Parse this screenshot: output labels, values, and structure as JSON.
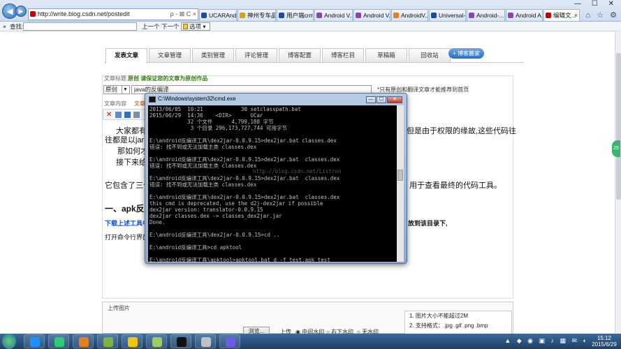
{
  "browser": {
    "address": "http://write.blog.csdn.net/postedit",
    "address_actions": "ρ - ⊠ C ×",
    "tabs": [
      {
        "label": "UCARAndr...",
        "color": "#1b4d9b"
      },
      {
        "label": "神州专车品...",
        "color": "#d4a017"
      },
      {
        "label": "用户端crm...",
        "color": "#1b4d9b"
      },
      {
        "label": "Android V...",
        "color": "#8e44ad"
      },
      {
        "label": "Android V...",
        "color": "#8e44ad"
      },
      {
        "label": "AndroidV...",
        "color": "#e67e22"
      },
      {
        "label": "Universal-...",
        "color": "#1b4d9b"
      },
      {
        "label": "Android-...",
        "color": "#8e44ad"
      },
      {
        "label": "Android A...",
        "color": "#8e44ad"
      },
      {
        "label": "编辑文...",
        "color": "#c00000",
        "active": true
      }
    ],
    "window_controls": "— ☐ ✕",
    "tool_icons": "⌂ ☆ ⚙"
  },
  "find_bar": {
    "close": "×",
    "label": "查找:",
    "prev": "上一个",
    "next": "下一个",
    "options": "选项 ▾"
  },
  "page": {
    "nav_tabs": [
      "发表文章",
      "文章管理",
      "类别管理",
      "评论管理",
      "博客配置",
      "博客栏目",
      "草稿箱",
      "回收站"
    ],
    "team_button": "+ 博客搬家",
    "title_label": "文章标题",
    "original_note": "原创 请保证您的文章为原创作品",
    "type_select": "原创",
    "title_value": "java的反编译",
    "right_note": "*只有原创和翻译文章才能推荐到首页",
    "content_label": "文章内容",
    "editor_label": "文章",
    "body": {
      "p1": "大家都有",
      "p1b": "往都是以jar",
      "p1_right": "但是由于权限的缘故,这些代码往",
      "p2": "那如何才",
      "p3": "接下来给",
      "p4": "它包含了三个",
      "p4_right": "用于查看最终的代码工具。",
      "h1": "一、apk反编",
      "blue": "下载上述工具中",
      "blue_right": "放到该目录下,",
      "cmdline": "打开命令行界面"
    },
    "upload": {
      "title": "上传图片",
      "browse": "浏览...",
      "upload_btn": "上传",
      "radios": [
        "中间水印",
        "右下水印",
        "无水印"
      ],
      "rule1": "1. 图片大小不能超过2M",
      "rule2": "2. 支持格式：.jpg .gif .png .bmp"
    },
    "side_badge": "25"
  },
  "cmd": {
    "title": "C:\\Windows\\system32\\cmd.exe",
    "lines": [
      "2013/06/05  10:21            30 setclasspath.bat",
      "2015/06/29  14:36    <DIR>      UCar",
      "            32 个文件      4,799,188 字节",
      "             3 个目录 296,173,727,744 可用字节",
      "",
      "E:\\android反编译工具\\dex2jar-0.0.9.15>dex2jar.bat classes.dex",
      "错误: 找不到或无法加载主类 classes.dex",
      "",
      "E:\\android反编译工具\\dex2jar-0.0.9.15>dex2jar.bat  classes.dex",
      "错误: 找不到或无法加载主类 classes.dex",
      "",
      "E:\\android反编译工具\\dex2jar-0.0.9.15>dex2jar.bat  classes.dex",
      "错误: 找不到或无法加载主类 classes.dex",
      "",
      "E:\\android反编译工具\\dex2jar-0.0.9.15>dex2jar.bat  classes.dex",
      "this cmd is deprecated, use the d2j-dex2jar if possible",
      "dex2jar version: translator-0.0.9.15",
      "dex2jar classes.dex -> classes_dex2jar.jar",
      "Done.",
      "",
      "E:\\android反编译工具\\dex2jar-0.0.9.15>cd ..",
      "",
      "E:\\android反编译工具>cd apktool",
      "",
      "E:\\android反编译工具\\apktool>apktool.bat d -f test.apk test"
    ],
    "watermark": "http://blog.csdn.net/Listron"
  },
  "taskbar": {
    "apps": [
      {
        "name": "ie-icon",
        "color": "#1e90ff"
      },
      {
        "name": "chrome-icon",
        "color": "#2ecc71"
      },
      {
        "name": "firefox-icon",
        "color": "#e67e22"
      },
      {
        "name": "android-studio-icon",
        "color": "#7cb342"
      },
      {
        "name": "explorer-icon",
        "color": "#f1c40f"
      },
      {
        "name": "android-icon",
        "color": "#9ccc65"
      },
      {
        "name": "cmd-icon",
        "color": "#111111"
      },
      {
        "name": "tool-icon",
        "color": "#bdc3c7"
      },
      {
        "name": "eclipse-icon",
        "color": "#6c5ce7"
      }
    ],
    "tray": "▲ ◆ ◉ ▣ ♪ ▦ ✉ ◐",
    "time": "15:12",
    "date": "2015/6/29"
  }
}
